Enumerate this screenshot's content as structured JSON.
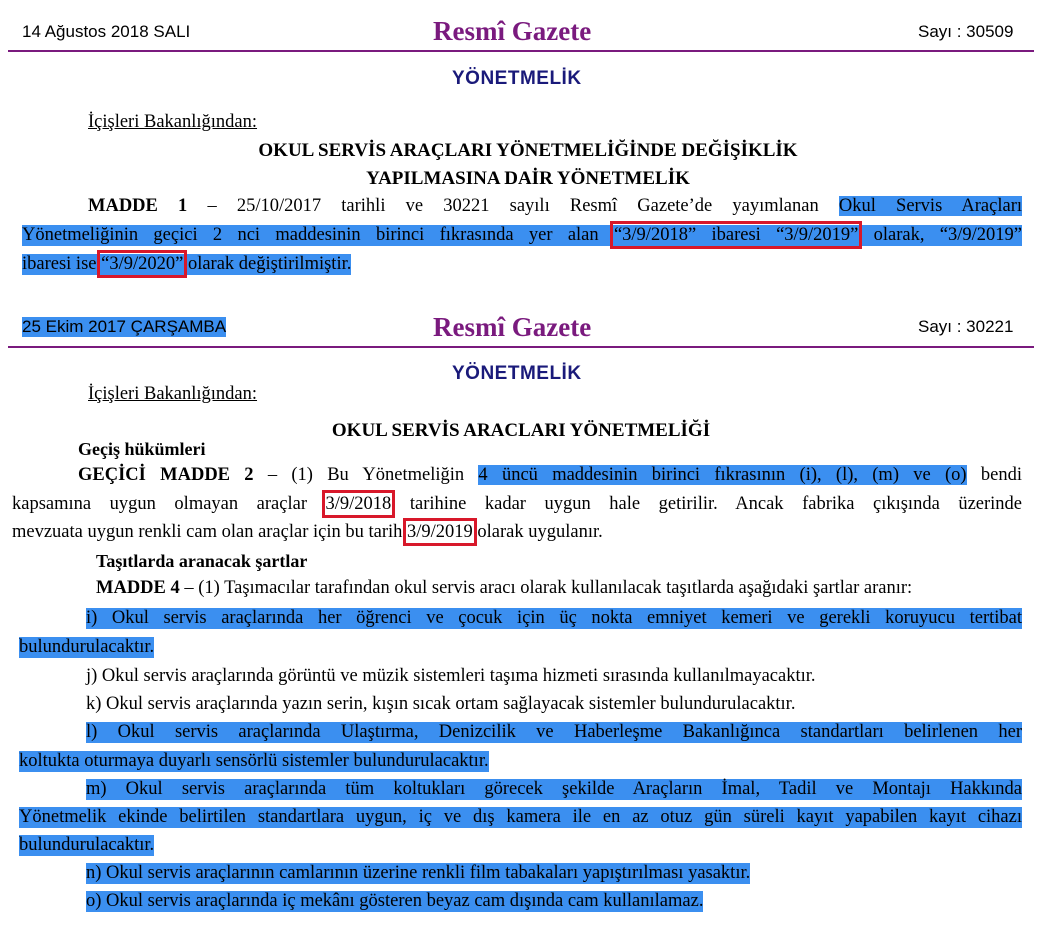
{
  "gazette1": {
    "date": "14 Ağustos 2018 SALI",
    "title": "Resmî Gazete",
    "sayi": "Sayı : 30509",
    "section": "YÖNETMELİK",
    "ministry": "İçişleri Bakanlığından:",
    "doc_title_1": "OKUL SERVİS ARAÇLARI YÖNETMELİĞİNDE DEĞİŞİKLİK",
    "doc_title_2": "YAPILMASINA DAİR YÖNETMELİK",
    "line1_bold": "MADDE 1",
    "line1_a": " – 25/10/2017 tarihli ve 30221 sayılı Resmî Gazete’de yayımlanan ",
    "line1_hl": "Okul Servis Araçları",
    "line2_a": "Yönetmeliğinin geçici 2 nci maddesinin birinci fıkrasında yer alan ",
    "line2_box": "“3/9/2018” ibaresi “3/9/2019”",
    "line2_b": " olarak, “3/9/2019”",
    "line3_a": "ibaresi ise ",
    "line3_box": "“3/9/2020”",
    "line3_b": " olarak değiştirilmiştir."
  },
  "gazette2": {
    "date": "25 Ekim 2017 ÇARŞAMBA",
    "title": "Resmî Gazete",
    "sayi": "Sayı : 30221",
    "section": "YÖNETMELİK",
    "ministry": "İçişleri Bakanlığından:",
    "doc_title": "OKUL SERVİS ARACLARI YÖNETMELİĞİ",
    "heading_gecis": "Geçiş hükümleri",
    "gecici_bold": "GEÇİCİ MADDE 2",
    "gecici_a": " – (1) Bu Yönetmeliğin ",
    "gecici_hl": "4 üncü maddesinin birinci fıkrasının (i), (l), (m) ve (o)",
    "gecici_b": " bendi",
    "line2_a": "kapsamına uygun olmayan araçlar ",
    "line2_box": "3/9/2018",
    "line2_b": " tarihine kadar uygun hale getirilir. Ancak fabrika çıkışında üzerinde",
    "line3_a": "mevzuata uygun renkli cam olan araçlar için bu tarih ",
    "line3_box": "3/9/2019",
    "line3_b": " olarak uygulanır.",
    "heading_tasit": "Taşıtlarda aranacak şartlar",
    "madde4_bold": "MADDE 4",
    "madde4_rest": " – (1) Taşımacılar tarafından okul servis aracı olarak kullanılacak taşıtlarda aşağıdaki şartlar aranır:",
    "items": {
      "i_1": "i) Okul servis araçlarında her öğrenci ve çocuk için üç nokta emniyet kemeri ve gerekli koruyucu tertibat",
      "i_2": "bulundurulacaktır.",
      "j": "j) Okul servis araçlarında görüntü ve müzik sistemleri taşıma hizmeti sırasında kullanılmayacaktır.",
      "k": "k) Okul servis araçlarında yazın serin, kışın sıcak ortam sağlayacak sistemler bulundurulacaktır.",
      "l_1": "l) Okul servis araçlarında Ulaştırma, Denizcilik ve Haberleşme Bakanlığınca standartları belirlenen her",
      "l_2": "koltukta oturmaya duyarlı sensörlü sistemler bulundurulacaktır.",
      "m_1": "m) Okul servis araçlarında tüm koltukları görecek şekilde Araçların İmal, Tadil ve Montajı Hakkında",
      "m_2": "Yönetmelik ekinde belirtilen standartlara uygun, iç ve dış kamera ile en az otuz gün süreli kayıt yapabilen kayıt cihazı",
      "m_3": "bulundurulacaktır.",
      "n": "n) Okul servis araçlarının camlarının üzerine renkli film tabakaları yapıştırılması yasaktır.",
      "o": "o) Okul servis araçlarında iç mekânı gösteren beyaz cam dışında cam kullanılamaz."
    }
  },
  "colors": {
    "highlight": "#3b8ff0",
    "box": "#d8182a",
    "title": "#7a1a7e",
    "section": "#1a1a7a"
  }
}
